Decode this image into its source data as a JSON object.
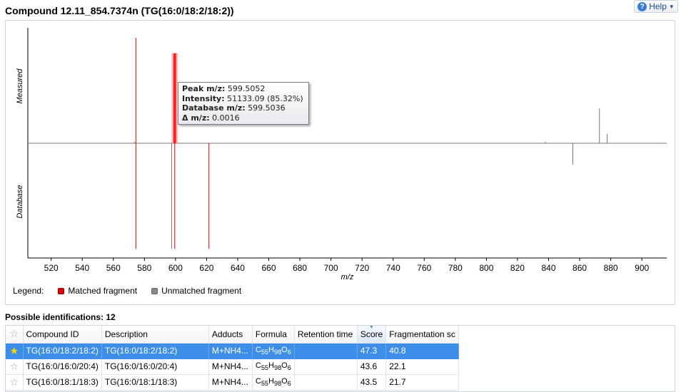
{
  "title": "Compound 12.11_854.7374n (TG(16:0/18:2/18:2))",
  "help": {
    "label": "Help"
  },
  "chart_data": {
    "type": "bar",
    "xlabel": "m/z",
    "upper_label": "Measured",
    "lower_label": "Database",
    "xlim": [
      505,
      916
    ],
    "xticks": [
      520,
      540,
      560,
      580,
      600,
      620,
      640,
      660,
      680,
      700,
      720,
      740,
      760,
      780,
      800,
      820,
      840,
      860,
      880,
      900
    ],
    "measured_peaks": [
      {
        "mz": 574.5,
        "intensity": 100,
        "matched": true
      },
      {
        "mz": 599.5052,
        "intensity": 85.32,
        "matched": true,
        "highlighted": true
      },
      {
        "mz": 573.5,
        "intensity": 1.5,
        "matched": false
      },
      {
        "mz": 838.0,
        "intensity": 1.5,
        "matched": false
      },
      {
        "mz": 872.7,
        "intensity": 33,
        "matched": false
      },
      {
        "mz": 877.7,
        "intensity": 9,
        "matched": false
      }
    ],
    "database_peaks": [
      {
        "mz": 574.5,
        "intensity": 100,
        "matched": true
      },
      {
        "mz": 597.5,
        "intensity": 100,
        "matched": false
      },
      {
        "mz": 599.5036,
        "intensity": 100,
        "matched": true
      },
      {
        "mz": 621.5,
        "intensity": 100,
        "matched": true
      },
      {
        "mz": 855.6,
        "intensity": 20,
        "matched": false
      }
    ],
    "extra_measured": [
      {
        "mz": 855.6,
        "intensity": 18,
        "matched": false
      }
    ],
    "colors": {
      "matched": "#e00000",
      "unmatched": "#777777",
      "highlight": "#ff2020"
    },
    "legend": {
      "label": "Legend:",
      "matched": "Matched fragment",
      "unmatched": "Unmatched fragment"
    }
  },
  "tooltip": {
    "peak_label": "Peak m/z:",
    "peak_value": "599.5052",
    "intensity_label": "Intensity:",
    "intensity_value": "51133.09 (85.32%)",
    "db_label": "Database m/z:",
    "db_value": "599.5036",
    "delta_label": "Δ m/z:",
    "delta_value": "0.0016"
  },
  "identifications": {
    "label": "Possible identifications: 12",
    "columns": [
      "Compound ID",
      "Description",
      "Adducts",
      "Formula",
      "Retention time",
      "Score",
      "Fragmentation sc"
    ],
    "rows": [
      {
        "compound_id": "TG(16:0/18:2/18:2)",
        "description": "TG(16:0/18:2/18:2)",
        "adducts": "M+NH4...",
        "formula_c": "55",
        "formula_h": "98",
        "formula_o": "6",
        "retention": "",
        "score": "47.3",
        "frag": "40.8",
        "selected": true
      },
      {
        "compound_id": "TG(16:0/16:0/20:4)",
        "description": "TG(16:0/16:0/20:4)",
        "adducts": "M+NH4...",
        "formula_c": "55",
        "formula_h": "98",
        "formula_o": "6",
        "retention": "",
        "score": "43.6",
        "frag": "22.1",
        "selected": false
      },
      {
        "compound_id": "TG(16:0/18:1/18:3)",
        "description": "TG(16:0/18:1/18:3)",
        "adducts": "M+NH4...",
        "formula_c": "55",
        "formula_h": "98",
        "formula_o": "6",
        "retention": "",
        "score": "43.5",
        "frag": "21.7",
        "selected": false
      }
    ]
  }
}
